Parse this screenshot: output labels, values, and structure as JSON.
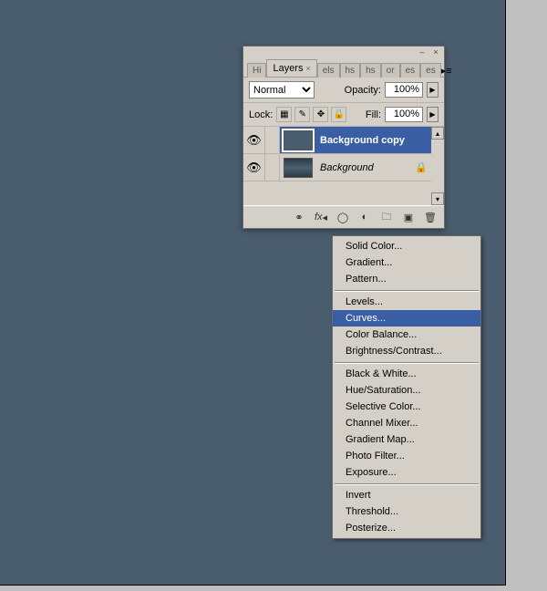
{
  "canvas": {},
  "panel": {
    "tabs": [
      "Hi",
      "Layers",
      "els",
      "hs",
      "hs",
      "or",
      "es",
      "es"
    ],
    "active_tab_index": 1,
    "blend_mode": "Normal",
    "opacity_label": "Opacity:",
    "opacity_value": "100%",
    "lock_label": "Lock:",
    "fill_label": "Fill:",
    "fill_value": "100%",
    "layers": [
      {
        "name": "Background copy",
        "visible": true,
        "selected": true,
        "locked": false
      },
      {
        "name": "Background",
        "visible": true,
        "selected": false,
        "locked": true
      }
    ],
    "footer_icons": [
      "link",
      "fx",
      "mask",
      "adjust",
      "group",
      "new",
      "trash"
    ]
  },
  "context_menu": {
    "groups": [
      [
        "Solid Color...",
        "Gradient...",
        "Pattern..."
      ],
      [
        "Levels...",
        "Curves...",
        "Color Balance...",
        "Brightness/Contrast..."
      ],
      [
        "Black & White...",
        "Hue/Saturation...",
        "Selective Color...",
        "Channel Mixer...",
        "Gradient Map...",
        "Photo Filter...",
        "Exposure..."
      ],
      [
        "Invert",
        "Threshold...",
        "Posterize..."
      ]
    ],
    "highlighted": "Curves..."
  }
}
